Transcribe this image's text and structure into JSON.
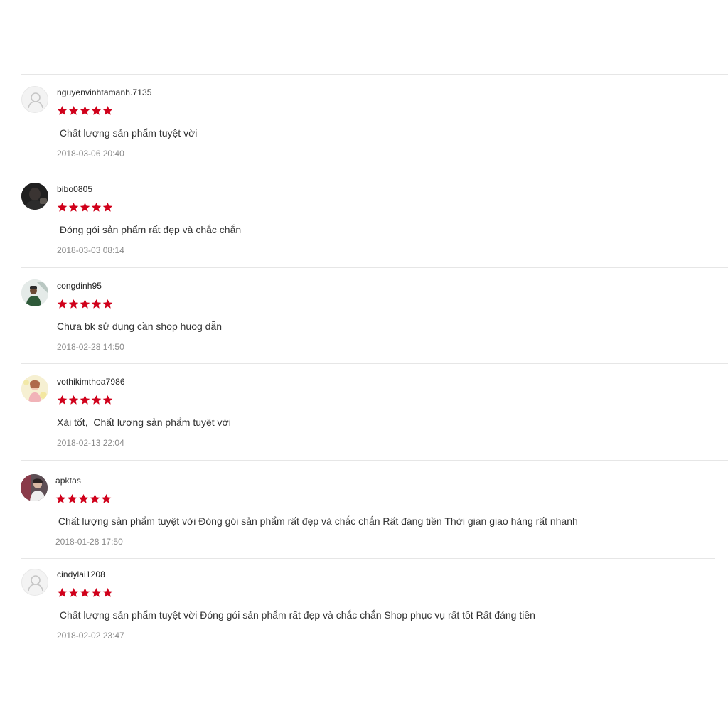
{
  "colors": {
    "star": "#d0011b",
    "divider": "#e6e6e6",
    "timestamp": "#8a8a8a"
  },
  "reviews": [
    {
      "username": "nguyenvinhtamanh.7135",
      "avatar": "default-avatar-icon",
      "rating": 5,
      "comment": " Chất lượng sản phẩm tuyệt vời",
      "time": "2018-03-06 20:40"
    },
    {
      "username": "bibo0805",
      "avatar": "user-photo-avatar",
      "rating": 5,
      "comment": " Đóng gói sản phẩm rất đẹp và chắc chắn",
      "time": "2018-03-03 08:14"
    },
    {
      "username": "congdinh95",
      "avatar": "user-photo-avatar",
      "rating": 5,
      "comment": "Chưa bk sử dụng cần shop huog dẫn",
      "time": "2018-02-28 14:50"
    },
    {
      "username": "vothikimthoa7986",
      "avatar": "user-photo-avatar",
      "rating": 5,
      "comment": "Xài tốt,  Chất lượng sản phẩm tuyệt vời",
      "time": "2018-02-13 22:04"
    },
    {
      "username": "apktas",
      "avatar": "user-photo-avatar",
      "rating": 5,
      "comment": " Chất lượng sản phẩm tuyệt vời Đóng gói sản phẩm rất đẹp và chắc chắn Rất đáng tiền Thời gian giao hàng rất nhanh",
      "time": "2018-01-28 17:50"
    },
    {
      "username": "cindylai1208",
      "avatar": "default-avatar-icon",
      "rating": 5,
      "comment": " Chất lượng sản phẩm tuyệt vời Đóng gói sản phẩm rất đẹp và chắc chắn Shop phục vụ rất tốt Rất đáng tiền",
      "time": "2018-02-02 23:47"
    }
  ]
}
